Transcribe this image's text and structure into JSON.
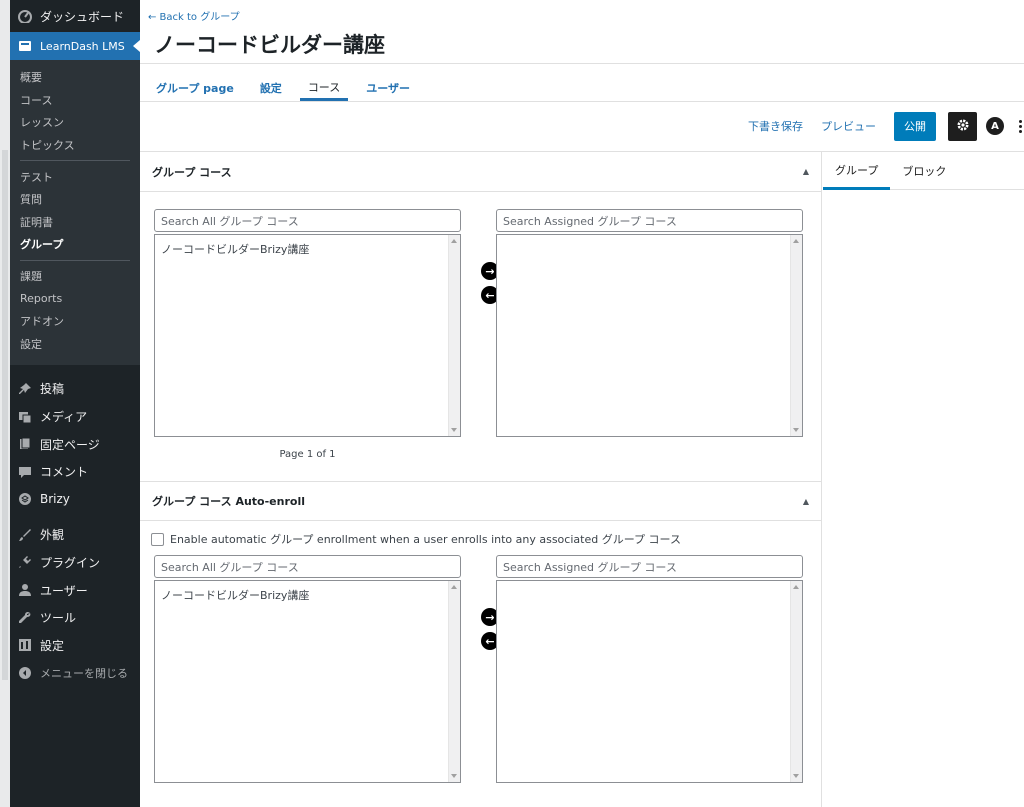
{
  "sidebar": {
    "dashboard": "ダッシュボード",
    "learndash": "LearnDash LMS",
    "sub_items": [
      {
        "label": "概要"
      },
      {
        "label": "コース"
      },
      {
        "label": "レッスン"
      },
      {
        "label": "トピックス"
      },
      {
        "label": "テスト"
      },
      {
        "label": "質問"
      },
      {
        "label": "証明書"
      },
      {
        "label": "グループ"
      },
      {
        "label": "課題"
      },
      {
        "label": "Reports"
      },
      {
        "label": "アドオン"
      },
      {
        "label": "設定"
      }
    ],
    "main_items": [
      {
        "label": "投稿",
        "icon": "pin-icon"
      },
      {
        "label": "メディア",
        "icon": "media-icon"
      },
      {
        "label": "固定ページ",
        "icon": "page-icon"
      },
      {
        "label": "コメント",
        "icon": "comment-icon"
      },
      {
        "label": "Brizy",
        "icon": "brizy-icon"
      },
      {
        "label": "外観",
        "icon": "brush-icon"
      },
      {
        "label": "プラグイン",
        "icon": "plugin-icon"
      },
      {
        "label": "ユーザー",
        "icon": "user-icon"
      },
      {
        "label": "ツール",
        "icon": "wrench-icon"
      },
      {
        "label": "設定",
        "icon": "settings-icon"
      }
    ],
    "collapse": "メニューを閉じる"
  },
  "header": {
    "back_link": "← Back to グループ",
    "title": "ノーコードビルダー講座",
    "tabs": [
      "グループ page",
      "設定",
      "コース",
      "ユーザー"
    ],
    "active_tab": "コース"
  },
  "toolbar": {
    "save_draft": "下書き保存",
    "preview": "プレビュー",
    "publish": "公開",
    "astra_glyph": "A"
  },
  "box1": {
    "title": "グループ コース",
    "search_all": "Search All グループ コース",
    "search_assigned": "Search Assigned グループ コース",
    "all_items": [
      "ノーコードビルダーBrizy講座"
    ],
    "pager": "Page 1 of 1"
  },
  "box2": {
    "title": "グループ コース Auto-enroll",
    "checkbox_label": "Enable automatic グループ enrollment when a user enrolls into any associated グループ コース",
    "search_all": "Search All グループ コース",
    "search_assigned": "Search Assigned グループ コース",
    "all_items": [
      "ノーコードビルダーBrizy講座"
    ]
  },
  "inspector": {
    "tabs": [
      "グループ",
      "ブロック"
    ]
  },
  "colors": {
    "sidebar_bg": "#1d2327",
    "accent": "#2271b1",
    "publish": "#007cba"
  }
}
